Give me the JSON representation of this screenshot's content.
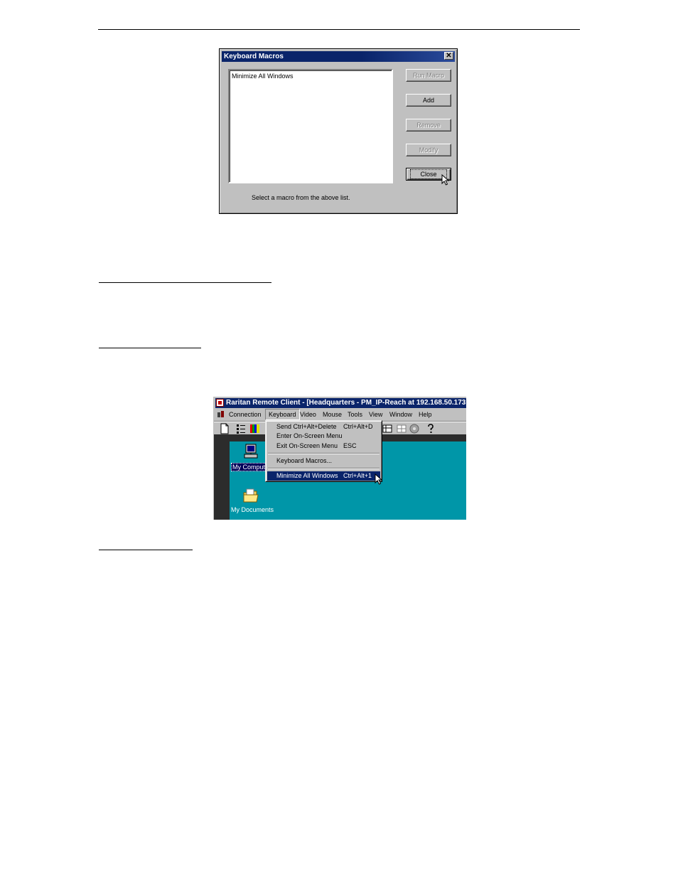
{
  "dialog": {
    "title": "Keyboard Macros",
    "close_glyph": "✕",
    "list_items": [
      "Minimize All Windows"
    ],
    "buttons": {
      "run_macro": "Run Macro",
      "add": "Add",
      "remove": "Remove",
      "modify": "Modify",
      "close": "Close"
    },
    "status_text": "Select a macro from the above list."
  },
  "app": {
    "title": "Raritan Remote Client - [Headquarters - PM_IP-Reach at 192.168.50.173",
    "menu": [
      "Connection",
      "Keyboard",
      "Video",
      "Mouse",
      "Tools",
      "View",
      "Window",
      "Help"
    ],
    "keyboard_menu": {
      "send_cad": "Send Ctrl+Alt+Delete",
      "send_cad_shortcut": "Ctrl+Alt+D",
      "enter_osm": "Enter On-Screen Menu",
      "exit_osm": "Exit On-Screen Menu",
      "exit_osm_shortcut": "ESC",
      "macros": "Keyboard Macros...",
      "minimize": "Minimize All Windows",
      "minimize_shortcut": "Ctrl+Alt+1"
    },
    "desktop": {
      "my_computer": "My Comput",
      "my_documents": "My Documents"
    }
  },
  "colors": {
    "titlebar": "#0a246a",
    "desktop": "#0096a8",
    "window_face": "#c0c0c0"
  }
}
